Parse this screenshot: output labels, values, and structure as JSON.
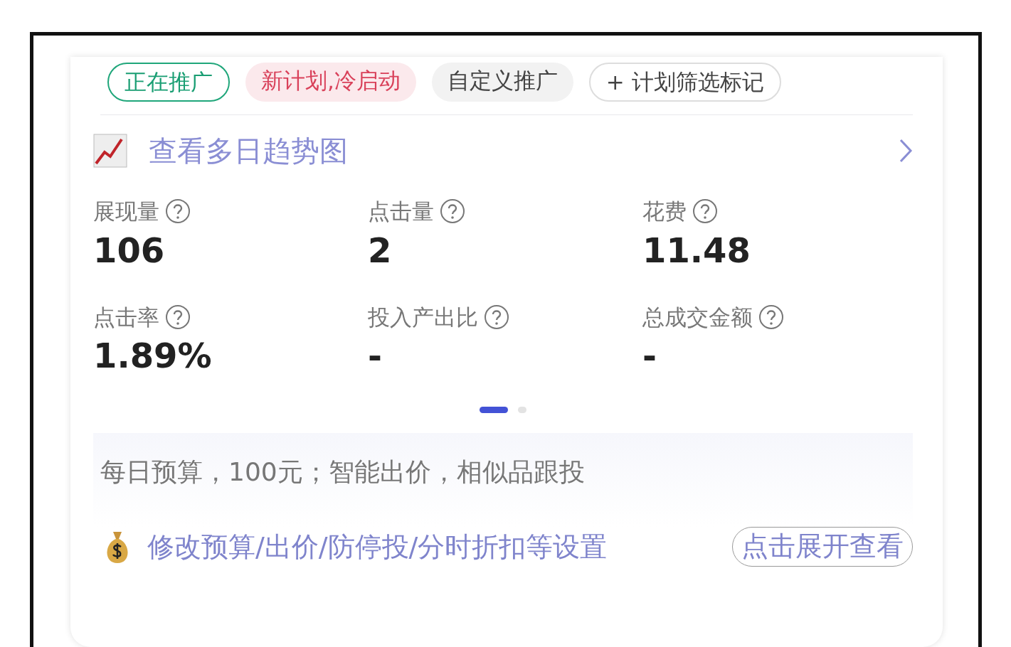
{
  "tags": [
    {
      "kind": "status",
      "label": "正在推广"
    },
    {
      "kind": "warning",
      "label": "新计划,冷启动"
    },
    {
      "kind": "plain",
      "label": "自定义推广"
    },
    {
      "kind": "add",
      "label": "+ 计划筛选标记"
    }
  ],
  "trend_link": {
    "label": "查看多日趋势图"
  },
  "metrics": [
    {
      "label": "展现量",
      "value": "106"
    },
    {
      "label": "点击量",
      "value": "2"
    },
    {
      "label": "花费",
      "value": "11.48"
    },
    {
      "label": "点击率",
      "value": "1.89%"
    },
    {
      "label": "投入产出比",
      "value": "-"
    },
    {
      "label": "总成交金额",
      "value": "-"
    }
  ],
  "pager": [
    {
      "selected": true
    },
    {
      "selected": false
    }
  ],
  "budget_summary": "每日预算，100元；智能出价，相似品跟投",
  "settings_link": {
    "label": "修改预算/出价/防停投/分时折扣等设置",
    "button": "点击展开查看"
  }
}
